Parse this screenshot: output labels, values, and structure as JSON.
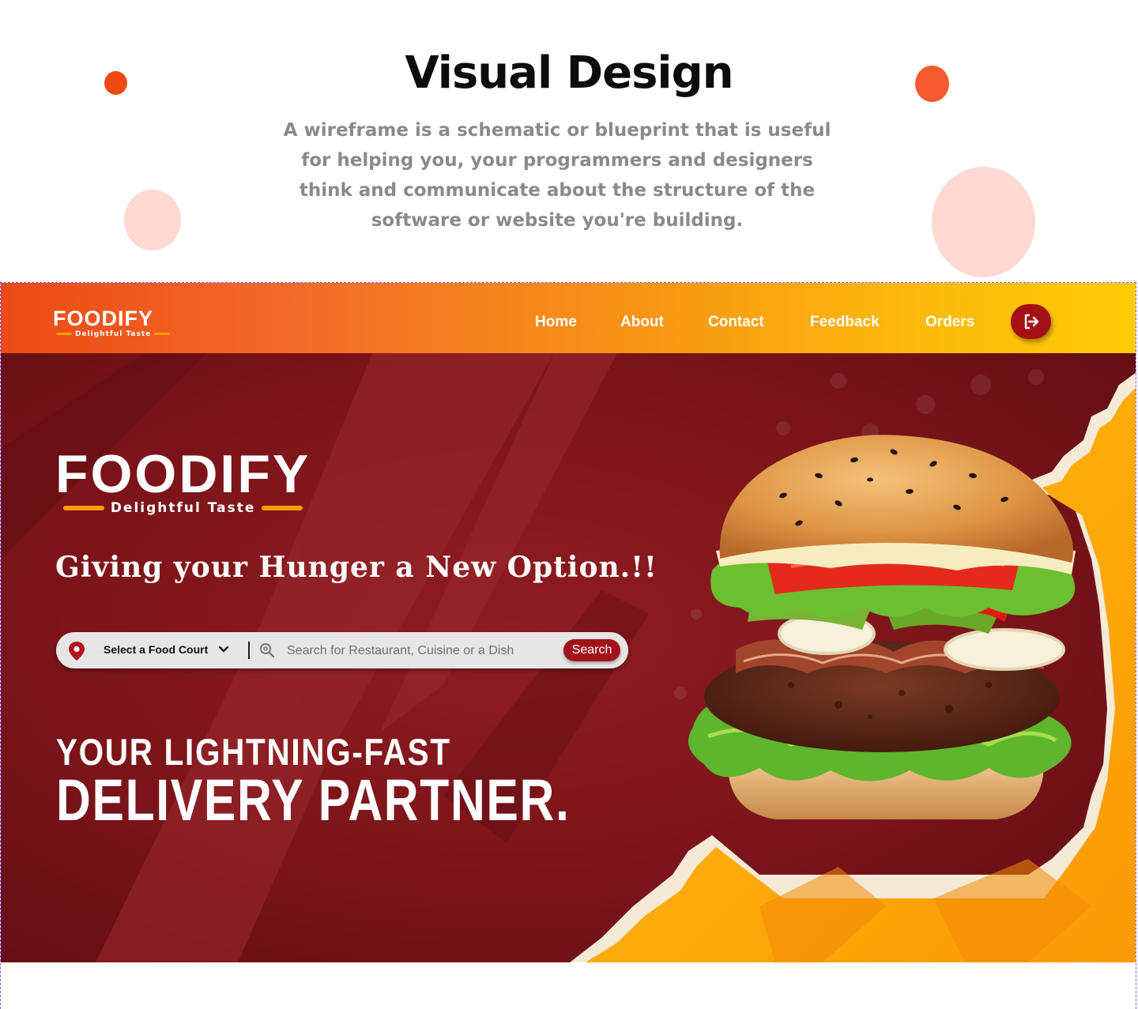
{
  "intro": {
    "title": "Visual Design",
    "description": "A wireframe is a schematic or blueprint that is useful for helping you, your programmers and designers think and communicate about the structure of the software or website you're building."
  },
  "brand": {
    "logo_text": "FOODIFY",
    "tagline": "Delightful Taste"
  },
  "nav": {
    "items": [
      "Home",
      "About",
      "Contact",
      "Feedback",
      "Orders"
    ],
    "logout_icon": "logout-icon"
  },
  "hero": {
    "slogan": "Giving your Hunger a New Option.!!",
    "headline_line1": "YOUR LIGHTNING-FAST",
    "headline_line2": "DELIVERY PARTNER.",
    "image": "burger-photo"
  },
  "search": {
    "location_label": "Select a Food Court",
    "placeholder": "Search for Restaurant, Cuisine or a Dish",
    "button_label": "Search"
  },
  "colors": {
    "nav_gradient_start": "#ec4a14",
    "nav_gradient_end": "#fdcb06",
    "hero_bg": "#7a141a",
    "accent_yellow": "#fca70a",
    "button_red": "#a3121a",
    "decor_orange": "#f04a12",
    "decor_pink": "#fdd9d2"
  }
}
